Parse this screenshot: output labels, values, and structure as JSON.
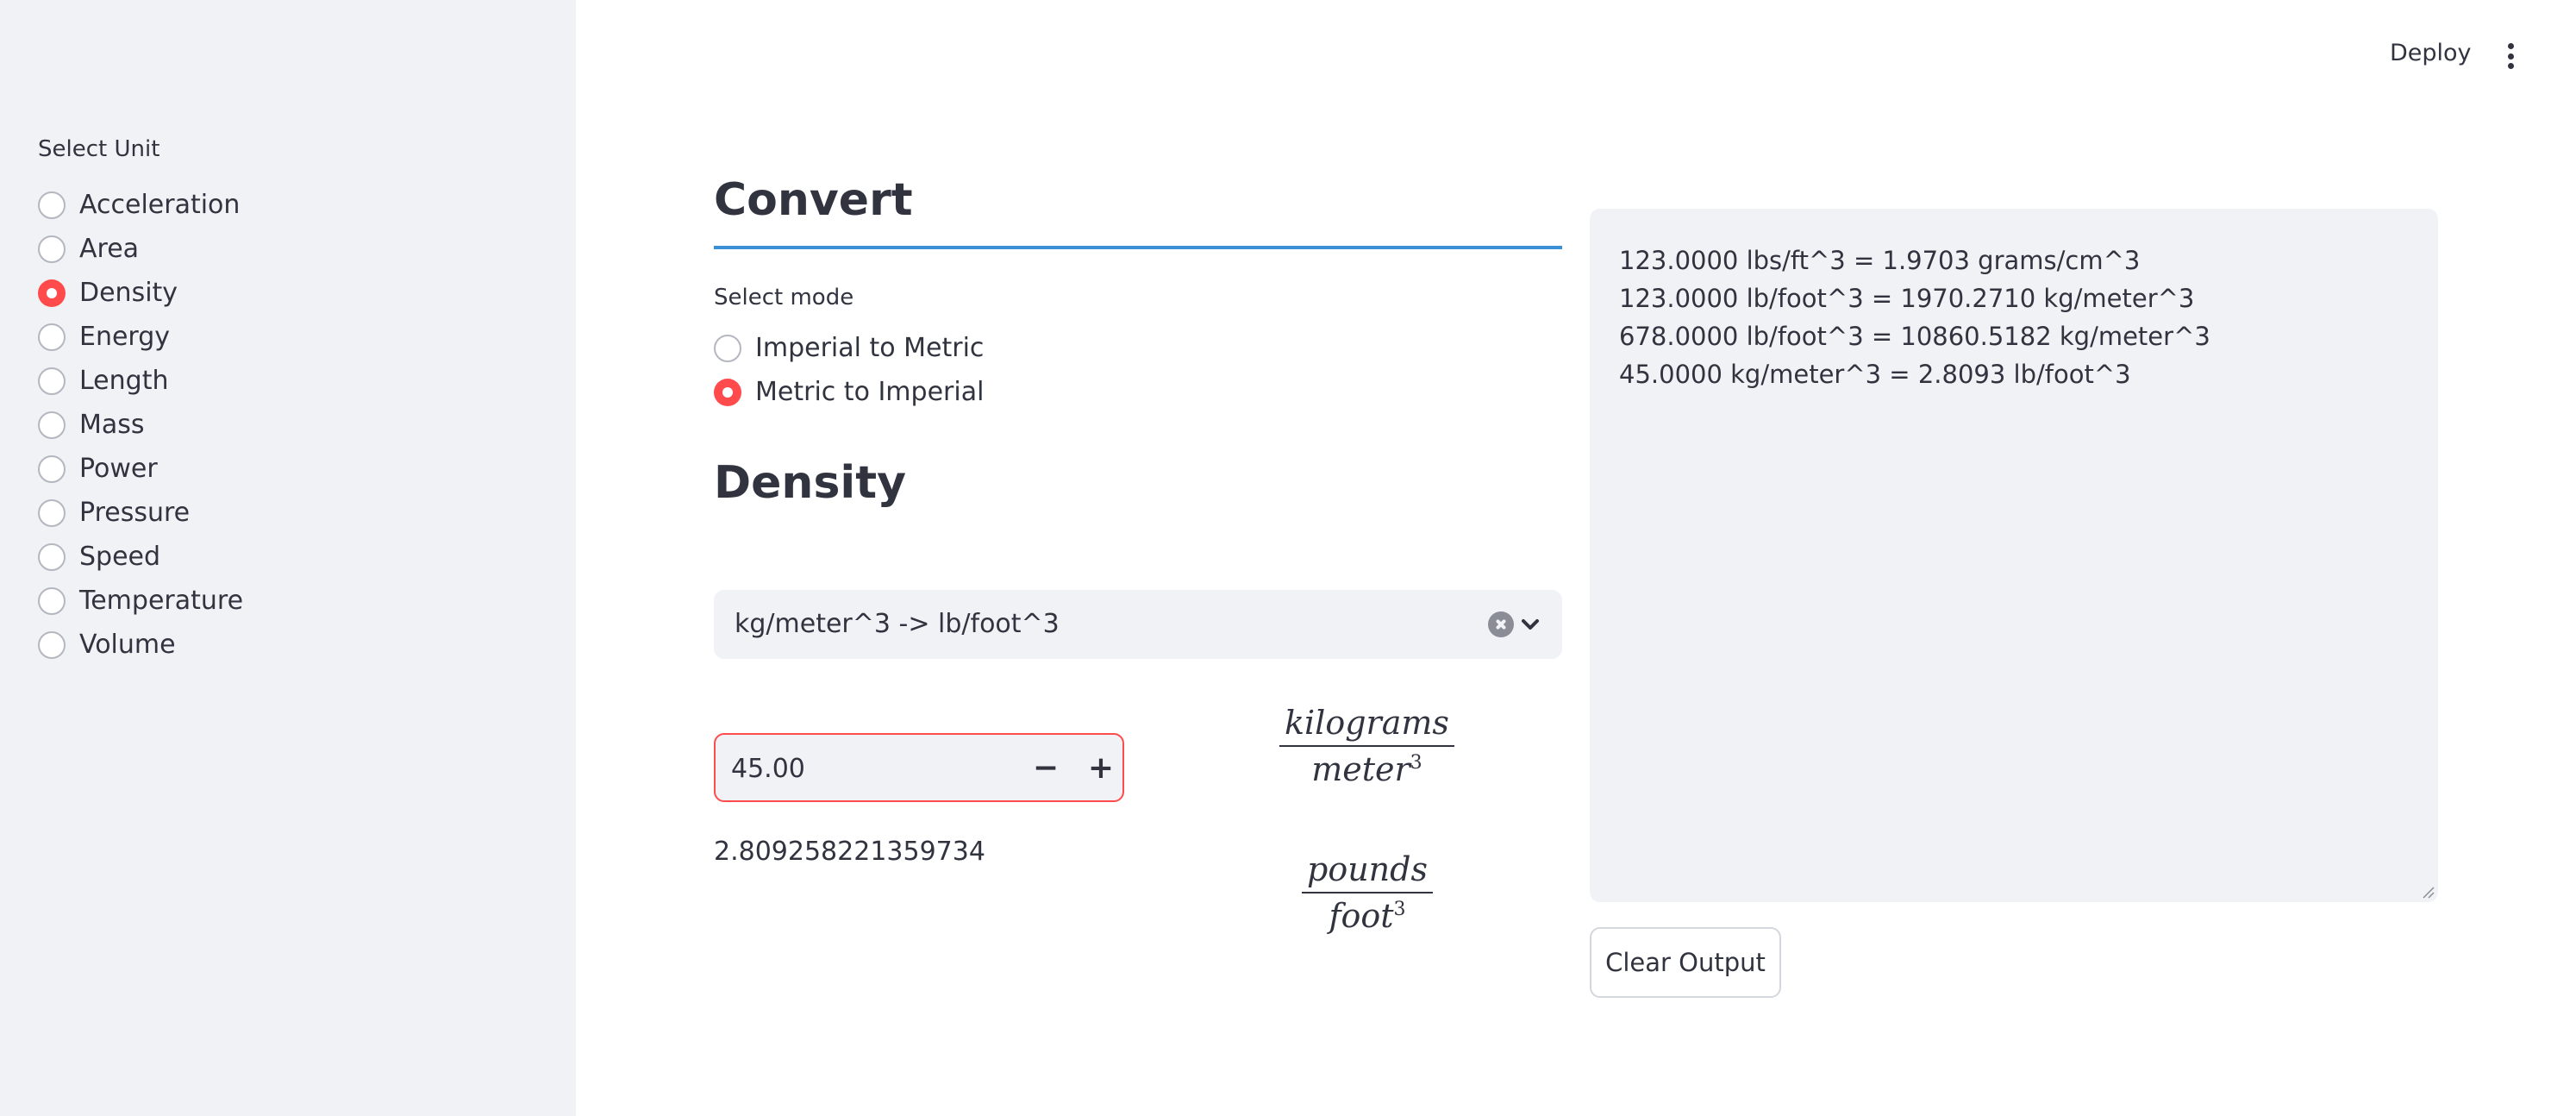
{
  "header": {
    "deploy_label": "Deploy",
    "menu_icon": "kebab-menu-icon"
  },
  "sidebar": {
    "label": "Select Unit",
    "selected": "Density",
    "options": [
      "Acceleration",
      "Area",
      "Density",
      "Energy",
      "Length",
      "Mass",
      "Power",
      "Pressure",
      "Speed",
      "Temperature",
      "Volume"
    ]
  },
  "main": {
    "convert_title": "Convert",
    "mode_label": "Select mode",
    "mode_selected": "Metric to Imperial",
    "modes": [
      "Imperial to Metric",
      "Metric to Imperial"
    ],
    "section_title": "Density",
    "conversion_select_value": "kg/meter^3 -> lb/foot^3",
    "input_value": "45.00",
    "minus_label": "−",
    "plus_label": "+",
    "result": "2.809258221359734",
    "from_unit": {
      "numerator": "kilograms",
      "denominator": "meter",
      "exponent": "3"
    },
    "to_unit": {
      "numerator": "pounds",
      "denominator": "foot",
      "exponent": "3"
    }
  },
  "output": {
    "lines": [
      "123.0000 lbs/ft^3 = 1.9703 grams/cm^3",
      "123.0000 lb/foot^3 = 1970.2710 kg/meter^3",
      "678.0000 lb/foot^3 = 10860.5182 kg/meter^3",
      "45.0000 kg/meter^3 = 2.8093 lb/foot^3"
    ],
    "clear_label": "Clear Output"
  },
  "colors": {
    "accent": "#ff4b4b",
    "divider": "#3a8fd9",
    "sidebar_bg": "#f0f2f6",
    "text": "#31333f"
  }
}
